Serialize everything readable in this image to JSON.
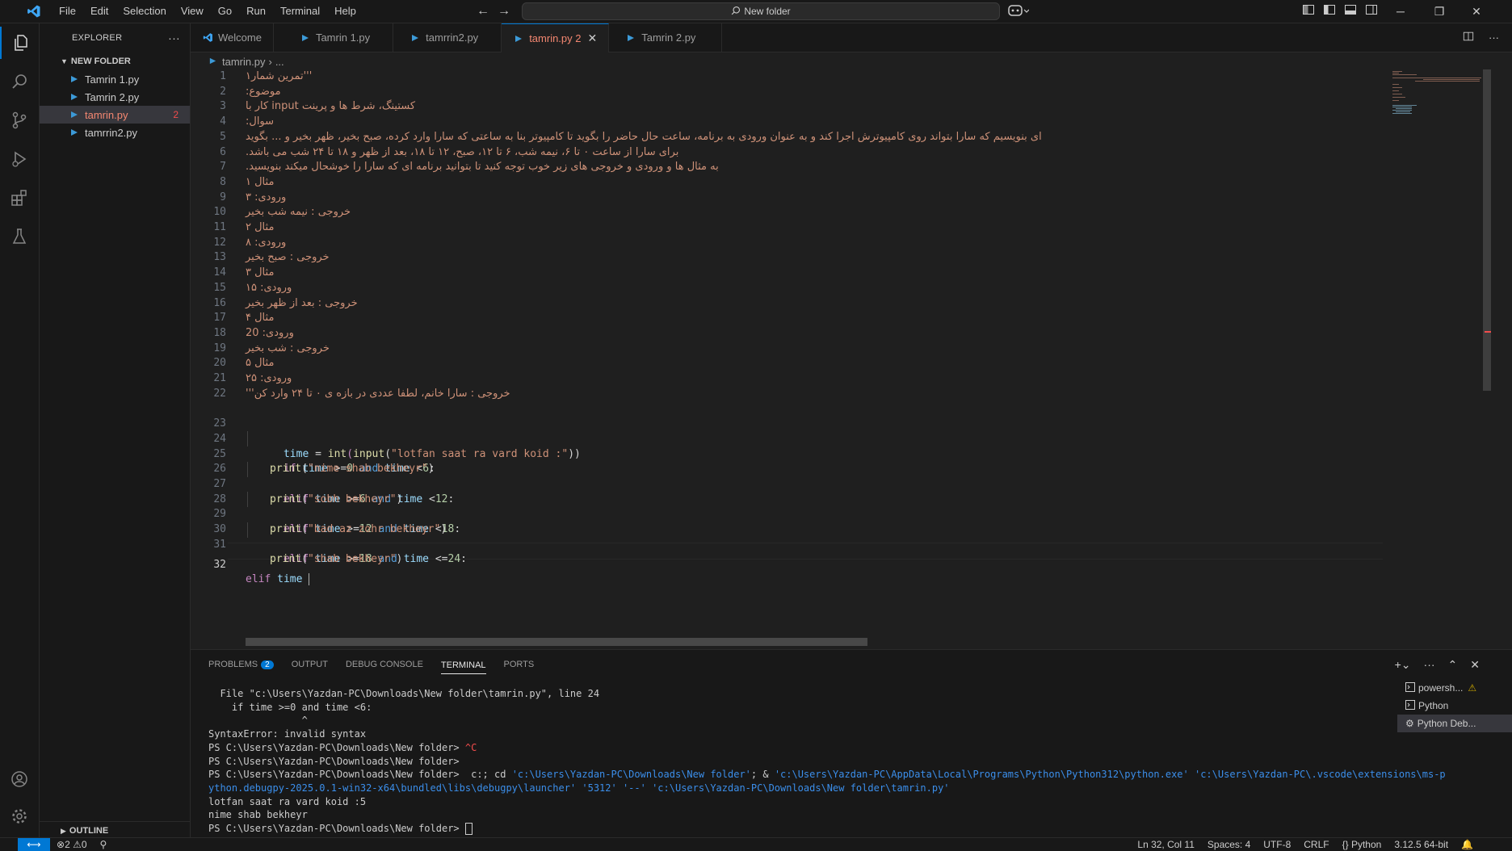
{
  "menu": [
    "File",
    "Edit",
    "Selection",
    "View",
    "Go",
    "Run",
    "Terminal",
    "Help"
  ],
  "search": {
    "text": "New folder"
  },
  "explorer": {
    "title": "EXPLORER",
    "folder": "NEW FOLDER",
    "files": [
      {
        "name": "Tamrin 1.py",
        "badge": ""
      },
      {
        "name": "Tamrin 2.py",
        "badge": ""
      },
      {
        "name": "tamrin.py",
        "badge": "2"
      },
      {
        "name": "tamrrin2.py",
        "badge": ""
      }
    ],
    "outline": "OUTLINE"
  },
  "tabs": [
    {
      "label": "Welcome"
    },
    {
      "label": "Tamrin 1.py"
    },
    {
      "label": "tamrrin2.py"
    },
    {
      "label": "tamrin.py 2"
    },
    {
      "label": "Tamrin 2.py"
    }
  ],
  "breadcrumb": {
    "file": "tamrin.py",
    "more": "..."
  },
  "editor": {
    "lines": [
      "'''تمرین شمار۱",
      "موضوع:",
      "کستینگ، شرط ها و پرینت input کار با",
      "سوال:",
      "ای بنویسیم که سارا بتواند روی کامپیوترش اجرا کند و به عنوان ورودی به برنامه، ساعت حال حاضر را بگوید تا کامپیوتر بنا به ساعتی که سارا وارد کرده، صبح بخیر، ظهر بخیر و ... بگوید",
      "برای سارا از ساعت ۰ تا ۶، نیمه شب، ۶ تا ۱۲، صبح، ۱۲ تا ۱۸، بعد از ظهر و ۱۸ تا ۲۴ شب می باشد.",
      "به مثال ها و ورودی و خروجی های زیر خوب توجه کنید تا بتوانید برنامه ای که سارا را خوشحال میکند بنویسید.",
      "مثال ۱",
      "ورودی: ۳",
      "خروجی : نیمه شب بخیر",
      "مثال ۲",
      "ورودی: ۸",
      "خروجی : صبح بخیر",
      "مثال ۳",
      "ورودی: ۱۵",
      "خروجی : بعد از ظهر بخیر",
      "مثال ۴",
      "ورودی: 20",
      "خروجی : شب بخیر",
      "مثال ۵",
      "ورودی: ۲۵",
      "خروجی : سارا خانم، لطفا عددی در بازه ی ۰ تا ۲۴ وارد کن'''"
    ],
    "code": {
      "l23": {
        "a": "time",
        "b": " = ",
        "c": "int",
        "d": "(",
        "e": "input",
        "f": "(",
        "g": "\"lotfan saat ra vard koid :\"",
        "h": "))"
      },
      "l24": {
        "kw": "if",
        "v": " time ",
        "op": ">=",
        "n": "0",
        "and": " and ",
        "v2": "time ",
        "op2": "<",
        "n2": "6",
        "end": ":"
      },
      "l25": {
        "fn": "print",
        "s": "\"nime shab bekheyr\""
      },
      "l26": {
        "kw": "elif",
        "v": " time ",
        "op": ">=",
        "n": "6",
        "and": " and ",
        "v2": "time ",
        "op2": "<",
        "n2": "12",
        "end": ":"
      },
      "l27": {
        "fn": "print",
        "s": "\"sobh bekheyr\""
      },
      "l28": {
        "kw": "elif",
        "v": " time ",
        "op": ">=",
        "n": "12",
        "and": " and ",
        "v2": "time ",
        "op2": "<",
        "n2": "18",
        "end": ":"
      },
      "l29": {
        "fn": "print",
        "s": "\"bad az zohr bekheyr\""
      },
      "l30": {
        "kw": "elif",
        "v": " time ",
        "op": ">=",
        "n": "18",
        "and": " and ",
        "v2": "time ",
        "op2": "<=",
        "n2": "24",
        "end": ":"
      },
      "l31": {
        "fn": "print",
        "s": "\"shab bekheyr\""
      },
      "l32": {
        "kw": "elif",
        "v": " time "
      }
    }
  },
  "panel": {
    "tabs": [
      "PROBLEMS",
      "OUTPUT",
      "DEBUG CONSOLE",
      "TERMINAL",
      "PORTS"
    ],
    "problems_count": "2",
    "terminal": {
      "l1": "  File \"c:\\Users\\Yazdan-PC\\Downloads\\New folder\\tamrin.py\", line 24",
      "l2": "    if time >=0 and time <6:",
      "l3": "                ^",
      "l4": "SyntaxError: invalid syntax",
      "l5a": "PS C:\\Users\\Yazdan-PC\\Downloads\\New folder> ",
      "l5b": "^C",
      "l6": "PS C:\\Users\\Yazdan-PC\\Downloads\\New folder>",
      "l7a": "PS C:\\Users\\Yazdan-PC\\Downloads\\New folder>  c:; cd ",
      "l7b": "'c:\\Users\\Yazdan-PC\\Downloads\\New folder'",
      "l7c": "; & ",
      "l7d": "'c:\\Users\\Yazdan-PC\\AppData\\Local\\Programs\\Python\\Python312\\python.exe' 'c:\\Users\\Yazdan-PC\\.vscode\\extensions\\ms-p",
      "l8": "ython.debugpy-2025.0.1-win32-x64\\bundled\\libs\\debugpy\\launcher' '5312' '--' 'c:\\Users\\Yazdan-PC\\Downloads\\New folder\\tamrin.py'",
      "l9": "lotfan saat ra vard koid :5",
      "l10": "nime shab bekheyr",
      "l11": "PS C:\\Users\\Yazdan-PC\\Downloads\\New folder> "
    },
    "terminals": [
      "powersh...",
      "Python",
      "Python Deb..."
    ]
  },
  "status": {
    "errors": "2",
    "warnings": "0",
    "position": "Ln 32, Col 11",
    "spaces": "Spaces: 4",
    "encoding": "UTF-8",
    "eol": "CRLF",
    "language": "Python",
    "interpreter": "3.12.5 64-bit"
  },
  "colors": {
    "accent": "#0078d4",
    "error": "#f48771"
  }
}
